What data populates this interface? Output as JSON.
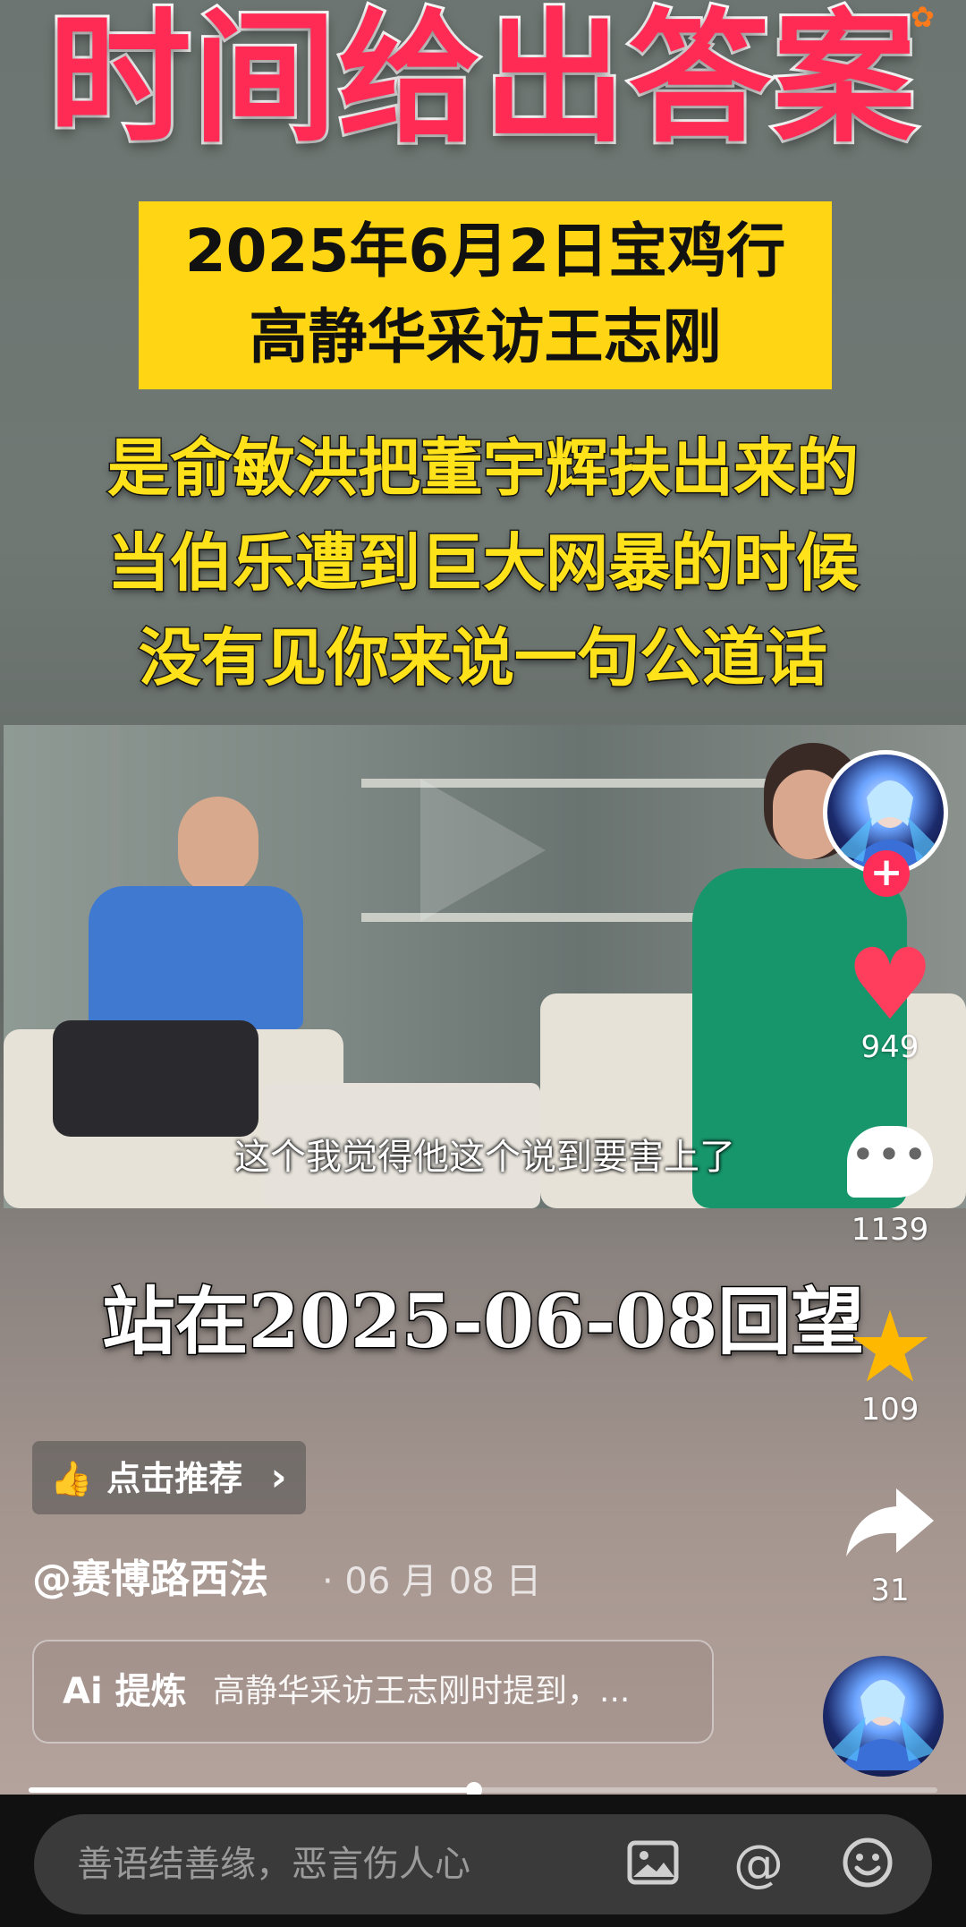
{
  "video": {
    "headline": "时间给出答案",
    "yellow_box": [
      "2025年6月2日宝鸡行",
      "高静华采访王志刚"
    ],
    "claims": [
      "是俞敏洪把董宇辉扶出来的",
      "当伯乐遭到巨大网暴的时候",
      "没有见你来说一句公道话"
    ],
    "subtitle": "这个我觉得他这个说到要害上了",
    "caption": "站在2025-06-08回望"
  },
  "rail": {
    "avatar_icon": "creator-avatar",
    "follow_label": "+",
    "likes": "949",
    "comments": "1139",
    "favorites": "109",
    "shares": "31"
  },
  "info": {
    "recommend_label": "点击推荐",
    "recommend_chevron": "›",
    "author": "@赛博路西法",
    "date": "· 06 月 08 日",
    "ai_label": "Ai 提炼",
    "ai_summary": "高静华采访王志刚时提到，..."
  },
  "progress": {
    "fraction": 0.49
  },
  "bottom_bar": {
    "placeholder": "善语结善缘，恶言伤人心",
    "icons": [
      "image-icon",
      "at-icon",
      "emoji-icon"
    ]
  },
  "colors": {
    "like": "#ff3e5e",
    "favorite": "#ffb800",
    "headline": "#ff2b55",
    "yellow_box": "#ffd514"
  }
}
